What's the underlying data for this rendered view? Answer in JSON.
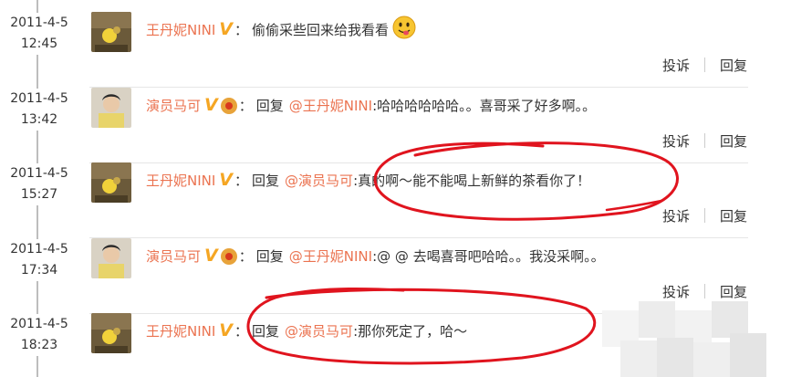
{
  "comments": [
    {
      "date": "2011-4-5",
      "time": "12:45",
      "user": "王丹妮NINI",
      "avatar": "photo-avatar-yellow",
      "has_medal": false,
      "reply_label": "",
      "mention": "",
      "text": "偷偷采些回来给我看看",
      "emoji": "smiley-tongue-icon",
      "report": "投诉",
      "reply": "回复"
    },
    {
      "date": "2011-4-5",
      "time": "13:42",
      "user": "演员马可",
      "avatar": "photo-avatar-man",
      "has_medal": true,
      "reply_label": "回复",
      "mention": "@王丹妮NINI",
      "text": ":哈哈哈哈哈哈。。喜哥采了好多啊。。",
      "emoji": "",
      "report": "投诉",
      "reply": "回复"
    },
    {
      "date": "2011-4-5",
      "time": "15:27",
      "user": "王丹妮NINI",
      "avatar": "photo-avatar-yellow",
      "has_medal": false,
      "reply_label": "回复",
      "mention": "@演员马可",
      "text": ":真的啊～能不能喝上新鲜的茶看你了！",
      "emoji": "",
      "report": "投诉",
      "reply": "回复"
    },
    {
      "date": "2011-4-5",
      "time": "17:34",
      "user": "演员马可",
      "avatar": "photo-avatar-man",
      "has_medal": true,
      "reply_label": "回复",
      "mention": "@王丹妮NINI",
      "text": ":@ @ 去喝喜哥吧哈哈。。我没采啊。。",
      "emoji": "",
      "report": "投诉",
      "reply": "回复"
    },
    {
      "date": "2011-4-5",
      "time": "18:23",
      "user": "王丹妮NINI",
      "avatar": "photo-avatar-yellow",
      "has_medal": false,
      "reply_label": "回复",
      "mention": "@演员马可",
      "text": ":那你死定了，哈～",
      "emoji": "",
      "report": "",
      "reply": ""
    }
  ],
  "verified_badge": "V",
  "separator": "：",
  "colors": {
    "username": "#eb7350",
    "verified": "#f5a623",
    "annotation": "#e0141e",
    "timeline": "#bdbdbd"
  }
}
